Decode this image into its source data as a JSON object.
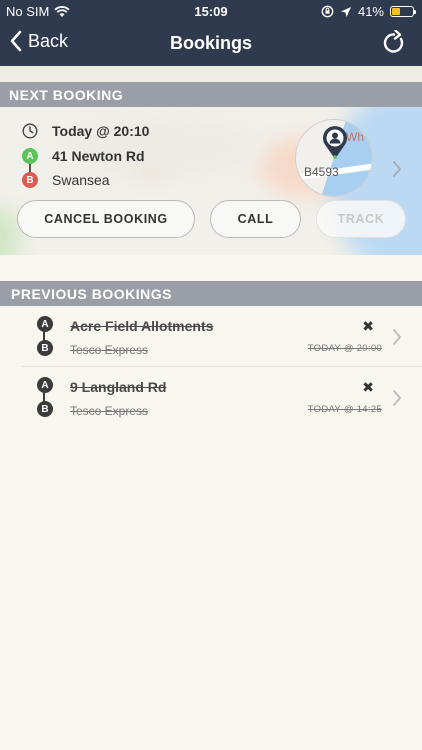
{
  "status": {
    "carrier": "No SIM",
    "time": "15:09",
    "battery": "41%",
    "battery_level": 0.41
  },
  "nav": {
    "back_label": "Back",
    "title": "Bookings"
  },
  "next": {
    "header": "NEXT BOOKING",
    "when": "Today @ 20:10",
    "from": "41 Newton Rd",
    "to": "Swansea",
    "pin_a": "A",
    "pin_b": "B",
    "map": {
      "road_label": "B4593",
      "place_label": "Wh"
    },
    "buttons": {
      "cancel": "CANCEL BOOKING",
      "call": "CALL",
      "track": "TRACK"
    }
  },
  "previous": {
    "header": "PREVIOUS BOOKINGS",
    "items": [
      {
        "from": "Acre Field Allotments",
        "to": "Tesco Express",
        "when": "TODAY @ 20:00"
      },
      {
        "from": "9 Langland Rd",
        "to": "Tesco Express",
        "when": "TODAY @ 14:25"
      }
    ]
  },
  "colors": {
    "topbar": "#2f3a4e",
    "header": "#9a9fa7",
    "pin_a": "#5cc558",
    "pin_b": "#e05a55",
    "battery": "#f2c21b"
  }
}
